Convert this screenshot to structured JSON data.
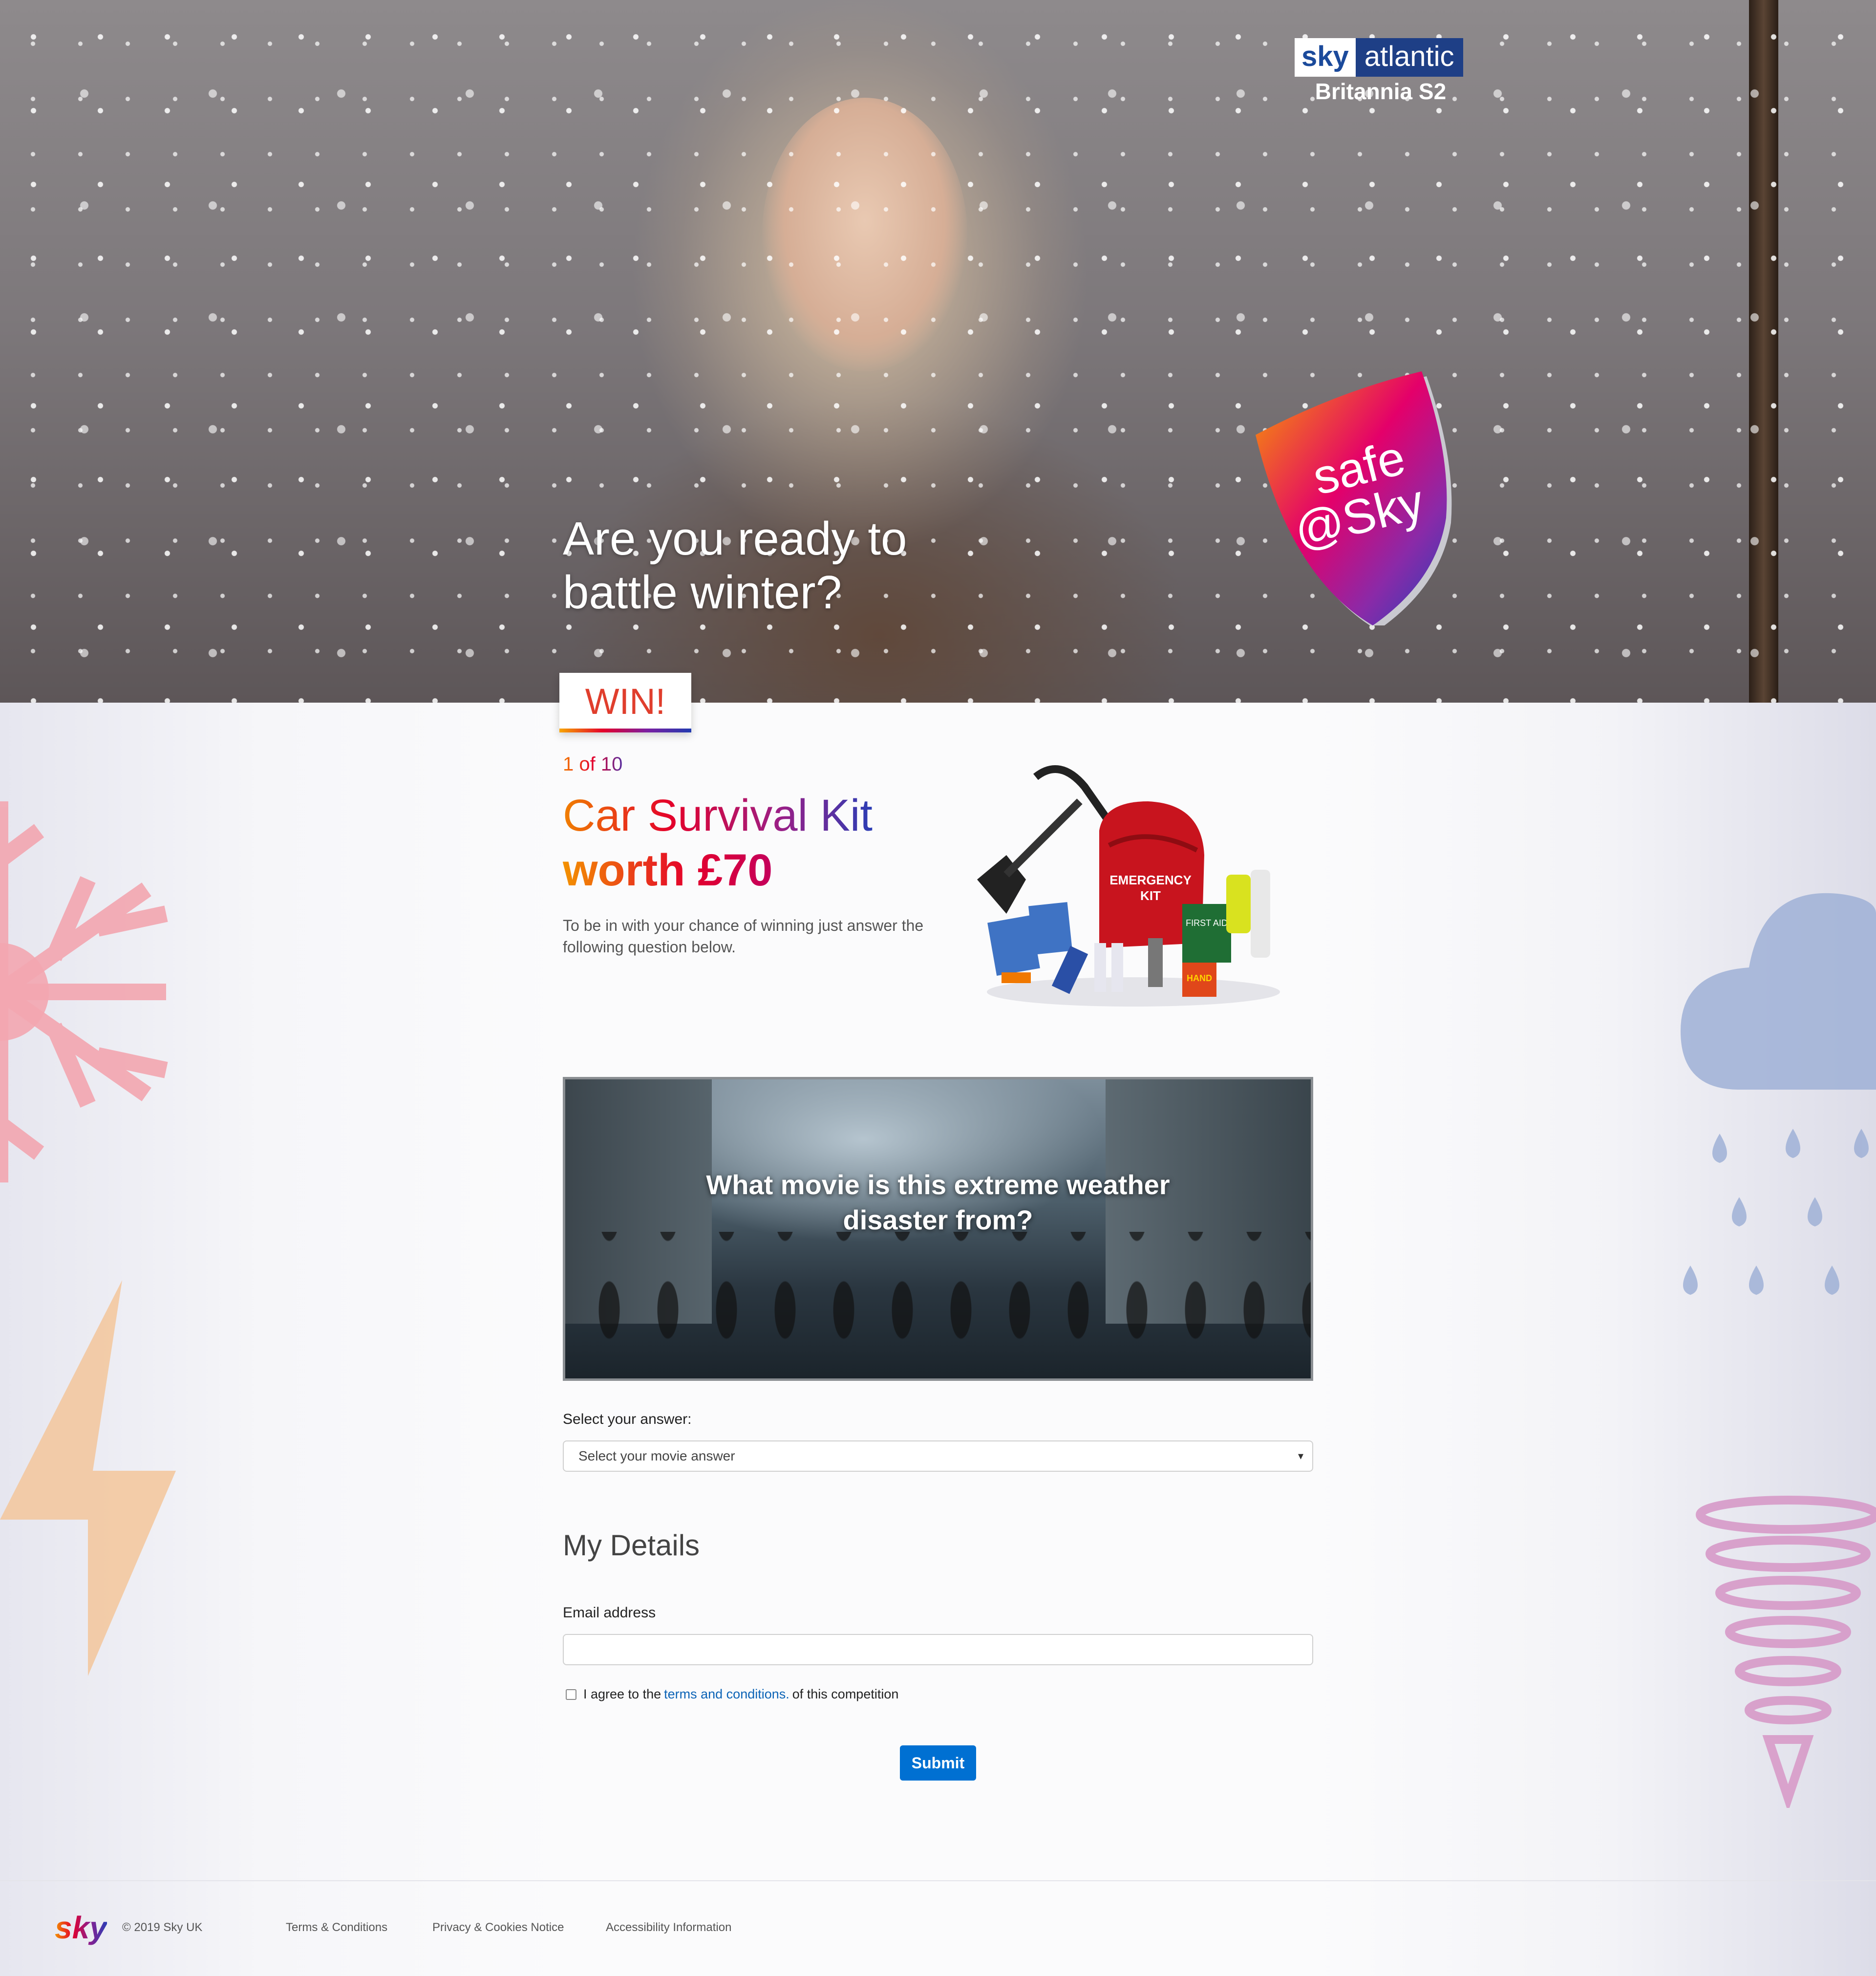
{
  "hero": {
    "title": "Are you ready to battle winter?",
    "brand_sky": "sky",
    "brand_channel": "atlantic",
    "brand_show": "Britannia S2",
    "shield_line1": "safe",
    "shield_line2": "@Sky"
  },
  "prize": {
    "badge": "WIN!",
    "count": "1 of 10",
    "title": "Car Survival Kit",
    "worth": "worth £70",
    "description": "To be in with your chance of winning just answer the following question below.",
    "kit_label_1": "EMERGENCY",
    "kit_label_2": "KIT",
    "kit_label_3": "FIRST AID",
    "kit_label_4": "HAND"
  },
  "question": {
    "text": "What movie is this extreme weather disaster from?",
    "answer_label": "Select your answer:",
    "answer_placeholder": "Select your movie answer"
  },
  "details": {
    "title": "My Details",
    "email_label": "Email address",
    "agree_prefix": "I agree to the",
    "agree_link": "terms and conditions.",
    "agree_suffix": "of this competition",
    "submit_label": "Submit"
  },
  "footer": {
    "logo": "sky",
    "copyright": "© 2019 Sky UK",
    "links": [
      "Terms & Conditions",
      "Privacy & Cookies Notice",
      "Accessibility Information"
    ]
  },
  "colors": {
    "accent_blue": "#0070d2",
    "link_blue": "#0b63b6",
    "snowflake": "#f3a6b0",
    "lightning": "#f3c8a0",
    "cloud": "#9fb0d6",
    "tornado": "#d79ac8"
  },
  "icons": [
    "snowflake-icon",
    "lightning-icon",
    "rain-cloud-icon",
    "tornado-icon",
    "dropdown-arrow-icon"
  ]
}
